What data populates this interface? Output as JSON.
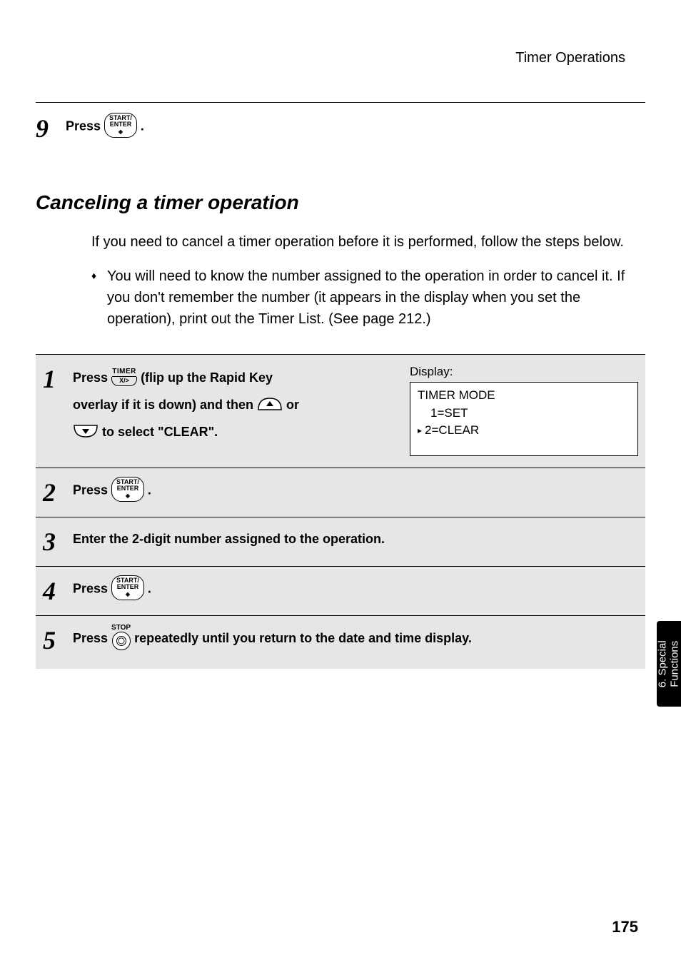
{
  "header": {
    "section_title": "Timer Operations"
  },
  "step9": {
    "num": "9",
    "prefix": "Press ",
    "button": {
      "line1": "START/",
      "line2": "ENTER",
      "diamond": "◈"
    },
    "suffix": " ."
  },
  "cancel": {
    "heading": "Canceling a timer operation",
    "intro": "If you need to cancel a timer operation before it is performed, follow the steps below.",
    "bullet": "You will need to know the number assigned to the operation in order to cancel it. If you don't remember the number (it appears in the display when you set the operation), print out the Timer List. (See page 212.)"
  },
  "steps": {
    "s1": {
      "num": "1",
      "t1": "Press ",
      "timer_top": "TIMER",
      "timer_bottom": "X/>",
      "t2": "  (flip up the Rapid Key",
      "t3": "overlay if it is down) and then ",
      "t4": " or",
      "t5": " to select \"CLEAR\".",
      "display_label": "Display:",
      "display": {
        "l1": "TIMER MODE",
        "l2": "1=SET",
        "l3": "2=CLEAR"
      }
    },
    "s2": {
      "num": "2",
      "t1": "Press ",
      "button": {
        "line1": "START/",
        "line2": "ENTER",
        "diamond": "◈"
      },
      "suffix": "."
    },
    "s3": {
      "num": "3",
      "text": "Enter the 2-digit number assigned to the operation."
    },
    "s4": {
      "num": "4",
      "t1": "Press ",
      "button": {
        "line1": "START/",
        "line2": "ENTER",
        "diamond": "◈"
      },
      "suffix": "."
    },
    "s5": {
      "num": "5",
      "t1": "Press ",
      "stop_label": "STOP",
      "t2": " repeatedly until you return to the date and time display."
    }
  },
  "side_tab": "6. Special\nFunctions",
  "page_number": "175"
}
